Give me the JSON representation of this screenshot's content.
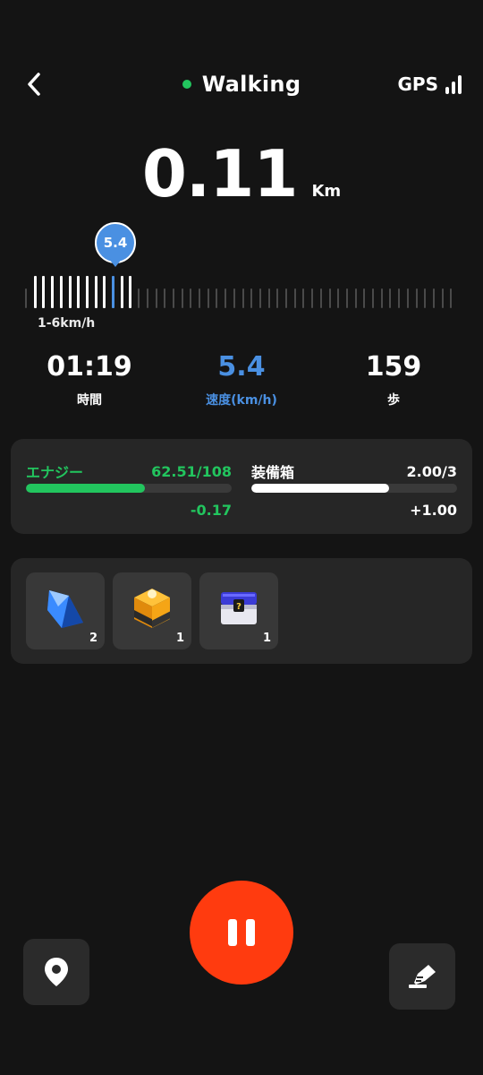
{
  "header": {
    "back_icon": "chevron-left-icon",
    "title": "Walking",
    "status_color": "#22c55e",
    "gps_label": "GPS",
    "gps_icon": "signal-bars-icon"
  },
  "distance": {
    "value": "0.11",
    "unit": "Km"
  },
  "speed_slider": {
    "current": "5.4",
    "range_label": "1-6km/h",
    "accent_color": "#4a90e2"
  },
  "stats": [
    {
      "value": "01:19",
      "label": "時間"
    },
    {
      "value": "5.4",
      "label": "速度(km/h)"
    },
    {
      "value": "159",
      "label": "歩"
    }
  ],
  "energy": {
    "label": "エナジー",
    "value": "62.51/108",
    "fill": 0.58,
    "delta": "-0.17",
    "color": "#22c55e"
  },
  "equipment": {
    "label": "装備箱",
    "value": "2.00/3",
    "fill": 0.67,
    "delta": "+1.00",
    "color": "#ffffff"
  },
  "items": [
    {
      "icon": "blue-crystal-icon",
      "count": "2"
    },
    {
      "icon": "orange-lootbox-icon",
      "count": "1"
    },
    {
      "icon": "mystery-chest-icon",
      "count": "1"
    }
  ],
  "controls": {
    "map_icon": "location-pin-icon",
    "pause_icon": "pause-icon",
    "edit_icon": "edit-icon",
    "pause_color": "#ff3b0f"
  }
}
